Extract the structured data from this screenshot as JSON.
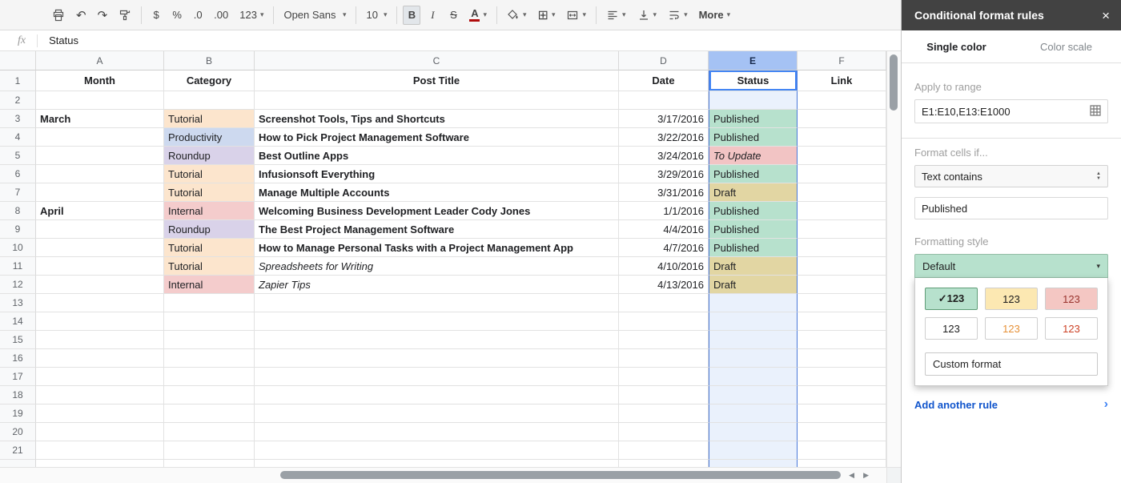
{
  "icons": {
    "caret": "▾",
    "close": "×",
    "chevron_right": "›",
    "stepper_up": "▲",
    "stepper_down": "▼",
    "scroll_left": "◀",
    "scroll_right": "▶",
    "undo": "↶",
    "redo": "↷",
    "borders": "⊞"
  },
  "toolbar": {
    "currency": "$",
    "percent": "%",
    "decimal_decrease": ".0",
    "decimal_increase": ".00",
    "number_format": "123",
    "font_name": "Open Sans",
    "font_size": "10",
    "bold": "B",
    "italic": "I",
    "strikethrough": "S",
    "text_color": "A",
    "more": "More"
  },
  "formula_bar": {
    "fx_label": "fx",
    "value": "Status"
  },
  "grid": {
    "column_letters": [
      "A",
      "B",
      "C",
      "D",
      "E",
      "F"
    ],
    "selected_column": "E",
    "selected_cell": "E1",
    "row_count": 21,
    "header_row": {
      "month": "Month",
      "category": "Category",
      "post_title": "Post Title",
      "date": "Date",
      "status": "Status",
      "link": "Link"
    },
    "rows": [
      {
        "n": 3,
        "month": "March",
        "category": "Tutorial",
        "title": "Screenshot Tools, Tips and Shortcuts",
        "date": "3/17/2016",
        "status": "Published"
      },
      {
        "n": 4,
        "category": "Productivity",
        "title": "How to Pick Project Management Software",
        "date": "3/22/2016",
        "status": "Published"
      },
      {
        "n": 5,
        "category": "Roundup",
        "title": "Best Outline Apps",
        "date": "3/24/2016",
        "status": "To Update",
        "status_italic": true
      },
      {
        "n": 6,
        "category": "Tutorial",
        "title": "Infusionsoft Everything",
        "date": "3/29/2016",
        "status": "Published"
      },
      {
        "n": 7,
        "category": "Tutorial",
        "title": "Manage Multiple Accounts",
        "date": "3/31/2016",
        "status": "Draft"
      },
      {
        "n": 8,
        "month": "April",
        "category": "Internal",
        "title": "Welcoming Business Development Leader Cody Jones",
        "date": "1/1/2016",
        "status": "Published"
      },
      {
        "n": 9,
        "category": "Roundup",
        "title": "The Best Project Management Software",
        "date": "4/4/2016",
        "status": "Published"
      },
      {
        "n": 10,
        "category": "Tutorial",
        "title": "How to Manage Personal Tasks with a Project Management App",
        "date": "4/7/2016",
        "status": "Published"
      },
      {
        "n": 11,
        "category": "Tutorial",
        "title": "Spreadsheets for Writing",
        "title_italic": true,
        "date": "4/10/2016",
        "status": "Draft"
      },
      {
        "n": 12,
        "category": "Internal",
        "title": "Zapier Tips",
        "title_italic": true,
        "date": "4/13/2016",
        "status": "Draft"
      }
    ]
  },
  "colors": {
    "category": {
      "Tutorial": "#fce5cd",
      "Productivity": "#cdd9ef",
      "Roundup": "#d9d2e9",
      "Internal": "#f4cccc"
    },
    "status": {
      "Published": "#b7e1cd",
      "To Update": "#f2c4c4",
      "Draft": "#e2d6a3"
    },
    "selection": "#4285f4",
    "selected_column_header": "#a5c2f4",
    "link_blue": "#1155cc"
  },
  "panel": {
    "title": "Conditional format rules",
    "tabs": [
      {
        "label": "Single color",
        "active": true
      },
      {
        "label": "Color scale",
        "active": false
      }
    ],
    "apply_to_range_label": "Apply to range",
    "range_value": "E1:E10,E13:E1000",
    "format_cells_label": "Format cells if...",
    "condition_select": "Text contains",
    "condition_value": "Published",
    "formatting_style_label": "Formatting style",
    "style_selected": "Default",
    "swatches": [
      {
        "label": "✓123",
        "bg": "#b7e1cd",
        "fg": "#1d1d1d",
        "selected": true
      },
      {
        "label": "123",
        "bg": "#fce8b2",
        "fg": "#1d1d1d"
      },
      {
        "label": "123",
        "bg": "#f4c7c3",
        "fg": "#99342e"
      },
      {
        "label": "123",
        "bg": "#ffffff",
        "fg": "#1d1d1d"
      },
      {
        "label": "123",
        "bg": "#ffffff",
        "fg": "#e69138"
      },
      {
        "label": "123",
        "bg": "#ffffff",
        "fg": "#cc4125"
      }
    ],
    "custom_format_label": "Custom format",
    "add_rule_label": "Add another rule"
  }
}
